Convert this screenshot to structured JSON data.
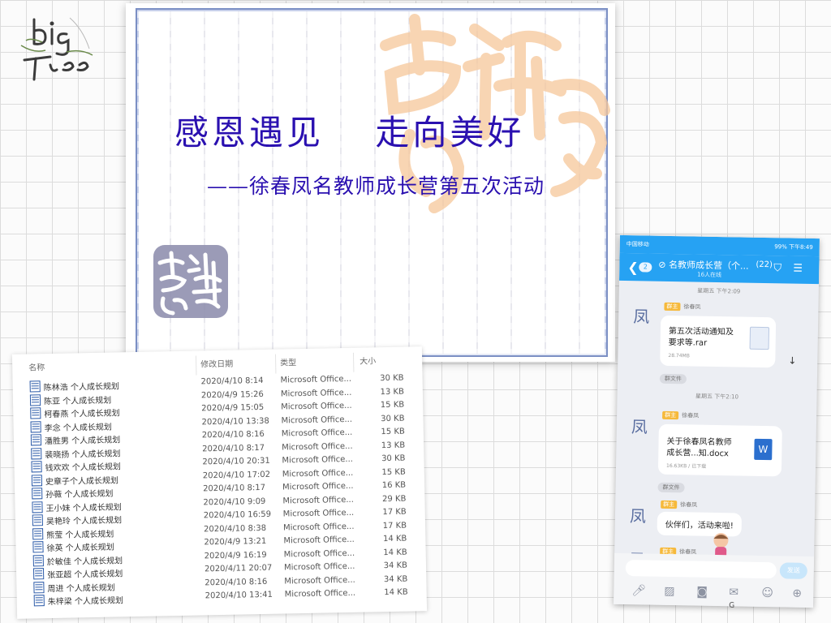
{
  "logo": {
    "line1": "big",
    "line2": "Tree"
  },
  "slide": {
    "title": "感恩遇见　 走向美好",
    "subtitle": "——徐春凤名教师成长营第五次活动",
    "watermark_text": "吉祥如意",
    "seal_text": "吉祥如意"
  },
  "file_list": {
    "headers": {
      "name": "名称",
      "date": "修改日期",
      "type": "类型",
      "size": "大小"
    },
    "rows": [
      {
        "name": "陈林浩 个人成长规划",
        "date": "2020/4/10 8:14",
        "type": "Microsoft Office...",
        "size": "30 KB"
      },
      {
        "name": "陈亚  个人成长规划",
        "date": "2020/4/9 15:26",
        "type": "Microsoft Office...",
        "size": "13 KB"
      },
      {
        "name": "柯春燕 个人成长规划",
        "date": "2020/4/9 15:05",
        "type": "Microsoft Office...",
        "size": "15 KB"
      },
      {
        "name": "李念 个人成长规划",
        "date": "2020/4/10 13:38",
        "type": "Microsoft Office...",
        "size": "30 KB"
      },
      {
        "name": "潘胜男 个人成长规划",
        "date": "2020/4/10 8:16",
        "type": "Microsoft Office...",
        "size": "15 KB"
      },
      {
        "name": "裴晓扬  个人成长规划",
        "date": "2020/4/10 8:17",
        "type": "Microsoft Office...",
        "size": "13 KB"
      },
      {
        "name": "钱欢欢 个人成长规划",
        "date": "2020/4/10 20:31",
        "type": "Microsoft Office...",
        "size": "30 KB"
      },
      {
        "name": "史章子个人成长规划",
        "date": "2020/4/10 17:02",
        "type": "Microsoft Office...",
        "size": "15 KB"
      },
      {
        "name": "孙薇 个人成长规划",
        "date": "2020/4/10 8:17",
        "type": "Microsoft Office...",
        "size": "16 KB"
      },
      {
        "name": "王小妹 个人成长规划",
        "date": "2020/4/10 9:09",
        "type": "Microsoft Office...",
        "size": "29 KB"
      },
      {
        "name": "吴艳玲 个人成长规划",
        "date": "2020/4/10 16:59",
        "type": "Microsoft Office...",
        "size": "17 KB"
      },
      {
        "name": "熊莹 个人成长规划",
        "date": "2020/4/10 8:38",
        "type": "Microsoft Office...",
        "size": "17 KB"
      },
      {
        "name": "徐英 个人成长规划",
        "date": "2020/4/9 13:21",
        "type": "Microsoft Office...",
        "size": "14 KB"
      },
      {
        "name": "於敏佳 个人成长规划",
        "date": "2020/4/9 16:19",
        "type": "Microsoft Office...",
        "size": "14 KB"
      },
      {
        "name": "张亚超 个人成长规划",
        "date": "2020/4/11 20:07",
        "type": "Microsoft Office...",
        "size": "34 KB"
      },
      {
        "name": "周进  个人成长规划",
        "date": "2020/4/10 8:16",
        "type": "Microsoft Office...",
        "size": "34 KB"
      },
      {
        "name": "朱梓梁 个人成长规划",
        "date": "2020/4/10 13:41",
        "type": "Microsoft Office...",
        "size": "14 KB"
      }
    ]
  },
  "phone": {
    "status_left": "中国移动",
    "status_right": "99%  下午8:49",
    "back_count": "2",
    "group_title": "名教师成长营（个...",
    "member_count": "(22)",
    "group_sub": "16人在线",
    "ts1": "星期五 下午2:09",
    "sender_rank": "群主",
    "sender_name": "徐春凤",
    "file1_name_l1": "第五次活动通知及",
    "file1_name_l2": "要求等.rar",
    "file1_size": "28.74MB",
    "chip1": "群文件",
    "ts2": "星期五 下午2:10",
    "file2_name_l1": "关于徐春凤名教师",
    "file2_name_l2": "成长营...知.docx",
    "file2_size": "16.63KB / 已下载",
    "chip2": "群文件",
    "msg_text": "伙伴们，活动来啦!",
    "send_label": "发送",
    "avatar_glyph": "凤"
  },
  "colors": {
    "title": "#2a10b0",
    "watermark": "#f6c79a",
    "qq_blue": "#26a2f3",
    "seal": "#6c6c9a"
  }
}
